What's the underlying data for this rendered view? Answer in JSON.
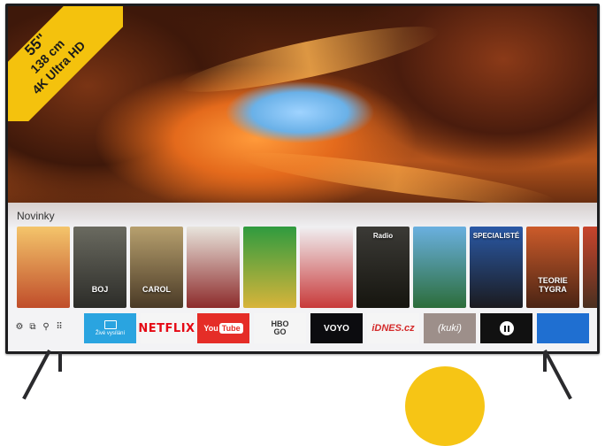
{
  "badge": {
    "size": "55\"",
    "cm": "138 cm",
    "resolution": "4K Ultra HD"
  },
  "ui": {
    "section_title": "Novinky",
    "posters": [
      {
        "title": "",
        "colors": [
          "#f4c56b",
          "#c04d2a"
        ]
      },
      {
        "title": "BOJ",
        "colors": [
          "#6a6a60",
          "#2c2c28"
        ]
      },
      {
        "title": "CAROL",
        "colors": [
          "#b7a06e",
          "#4a3a26"
        ]
      },
      {
        "title": "",
        "colors": [
          "#e8e4dc",
          "#8d2b2b"
        ]
      },
      {
        "title": "",
        "colors": [
          "#2f9b3f",
          "#d8b43a"
        ]
      },
      {
        "title": "",
        "colors": [
          "#f0f0f2",
          "#c83a3a"
        ]
      },
      {
        "title": "Radio",
        "colors": [
          "#3b3a36",
          "#16150f"
        ]
      },
      {
        "title": "",
        "colors": [
          "#6ab0e0",
          "#2c6d3a"
        ]
      },
      {
        "title": "SPECIALISTÉ",
        "colors": [
          "#2a59a6",
          "#1b1b1f"
        ]
      },
      {
        "title": "TEORIE TYGRA",
        "colors": [
          "#cc5b2a",
          "#4a2414"
        ]
      },
      {
        "title": "",
        "colors": [
          "#c8442c",
          "#4a3020"
        ]
      }
    ],
    "system_icons": [
      "settings-icon",
      "source-icon",
      "search-icon",
      "apps-icon"
    ],
    "apps": [
      {
        "id": "live",
        "label": "Živé vysílání"
      },
      {
        "id": "netflix",
        "label": "NETFLIX"
      },
      {
        "id": "youtube",
        "label_you": "You",
        "label_tube": "Tube"
      },
      {
        "id": "hbo",
        "label_top": "HBO",
        "label_bottom": "GO"
      },
      {
        "id": "voyo",
        "label": "VOYO"
      },
      {
        "id": "idnes",
        "label": "iDNES.cz"
      },
      {
        "id": "kuki",
        "label": "(kuki)"
      },
      {
        "id": "pause",
        "label": ""
      },
      {
        "id": "last",
        "label": ""
      }
    ]
  },
  "colors": {
    "badge": "#f4c20d",
    "panel": "#f3f3f5",
    "accent": "#2aa4e0"
  }
}
